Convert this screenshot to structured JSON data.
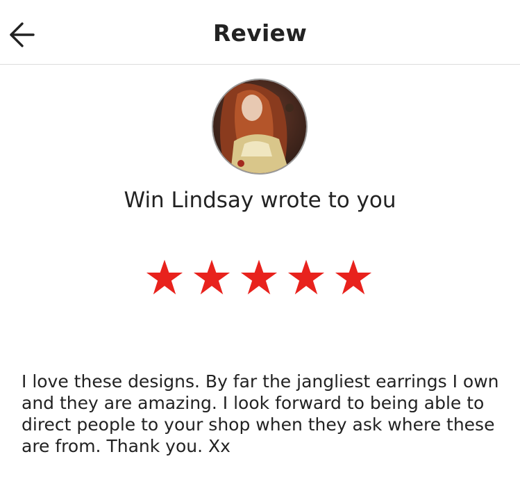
{
  "header": {
    "title": "Review",
    "back_icon": "arrow-left-icon"
  },
  "review": {
    "author_line": "Win Lindsay wrote to you",
    "rating": 5,
    "rating_max": 5,
    "star_color": "#e8221d",
    "text": "I love these designs. By far the jangliest earrings I own and they are amazing. I look forward to being able to direct people to your shop when they ask where these are from. Thank you. Xx"
  }
}
